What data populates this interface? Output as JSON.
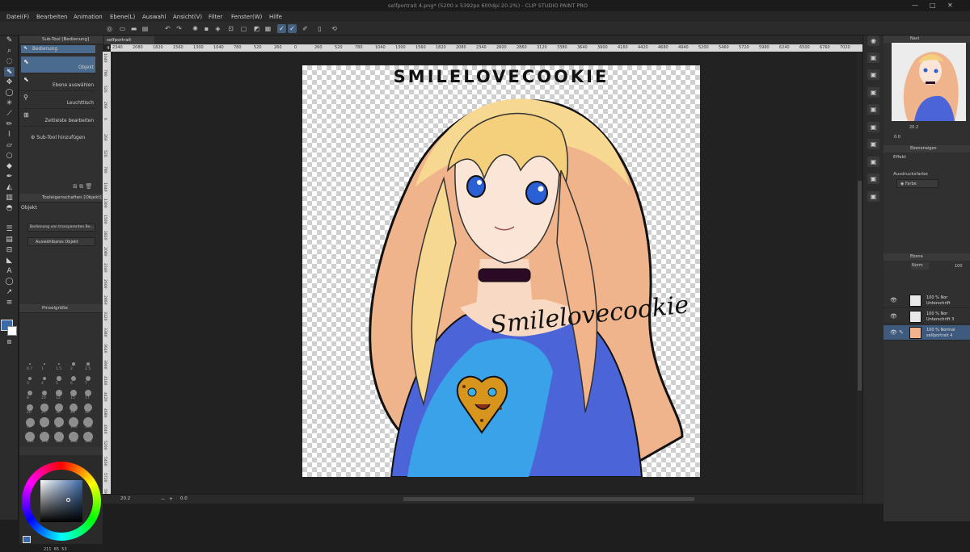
{
  "window": {
    "title": "selfportrait 4.png* (5200 x 5392px 600dpi 20.2%) - CLIP STUDIO PAINT PRO",
    "minimize": "—",
    "maximize": "□",
    "close": "✕"
  },
  "menu": [
    "Datei(F)",
    "Bearbeiten",
    "Animation",
    "Ebene(L)",
    "Auswahl",
    "Ansicht(V)",
    "Filter",
    "Fenster(W)",
    "Hilfe"
  ],
  "subtool_panel": {
    "header": "Sub-Tool [Bedienung]",
    "selected_tab": "Bedienung",
    "items": [
      "Objekt",
      "Ebene auswählen",
      "Leuchttisch",
      "Zeitleiste bearbeiten"
    ],
    "add_label": "Sub-Tool hinzufügen"
  },
  "tool_property": {
    "header": "Tooleigenschaften [Objekt]",
    "title": "Objekt",
    "dropdown1": "Bedienung von transparenten Be...",
    "dropdown2": "Auswählbares Objekt"
  },
  "brush_size": {
    "header": "Pinselgröße",
    "sizes": [
      "0.7",
      "1",
      "1.5",
      "2",
      "2.5",
      "3",
      "4",
      "5",
      "6",
      "7",
      "8",
      "10",
      "12",
      "15",
      "17",
      "20",
      "25",
      "30",
      "40",
      "50",
      "60",
      "70",
      "80",
      "100",
      "120",
      "150",
      "170",
      "200",
      "250",
      "300"
    ]
  },
  "color": {
    "readout": [
      "211",
      "65",
      "53"
    ],
    "main": "#3b6aa8",
    "sub": "#ffffff",
    "tint": "#4a86c5"
  },
  "document": {
    "tab": "selfportrait 4.png*"
  },
  "ruler": {
    "h": [
      "2340",
      "2080",
      "1820",
      "1560",
      "1300",
      "1040",
      "780",
      "520",
      "260",
      "0",
      "260",
      "520",
      "780",
      "1040",
      "1300",
      "1560",
      "1820",
      "2080",
      "2340",
      "2600",
      "2860",
      "3120",
      "3380",
      "3640",
      "3900",
      "4160",
      "4420",
      "4680",
      "4940",
      "5200",
      "5460",
      "5720",
      "5980",
      "6240",
      "6500",
      "6760",
      "7020"
    ],
    "v": [
      "1040",
      "780",
      "520",
      "260",
      "0",
      "260",
      "520",
      "780",
      "1040",
      "1300",
      "1560",
      "1820",
      "2080",
      "2340",
      "2600",
      "2860",
      "3120",
      "3380",
      "3640",
      "3900",
      "4160",
      "4420",
      "4680",
      "4940",
      "5200",
      "5460",
      "5720",
      "5980"
    ]
  },
  "artwork": {
    "title": "SMILELOVECOOKIE",
    "signature": "Smilelovecookie"
  },
  "status": {
    "zoom": "20.2",
    "rotate": "0.0"
  },
  "navigator": {
    "header": "Navi",
    "zoom": "20.2",
    "rotate": "0.0"
  },
  "layer_property": {
    "header": "Ebeneneigen",
    "effect_label": "Effekt",
    "expression_label": "Ausdrucksfarbe",
    "expression_value": "Farbe"
  },
  "layers": {
    "header": "Ebene",
    "blend": "Norm",
    "opacity": "100",
    "items": [
      {
        "line1": "100 % Nor",
        "line2": "Unterschrift"
      },
      {
        "line1": "100 % Nor",
        "line2": "Unterschrift 3"
      },
      {
        "line1": "100 % Normal",
        "line2": "selfportrait 4"
      }
    ]
  }
}
